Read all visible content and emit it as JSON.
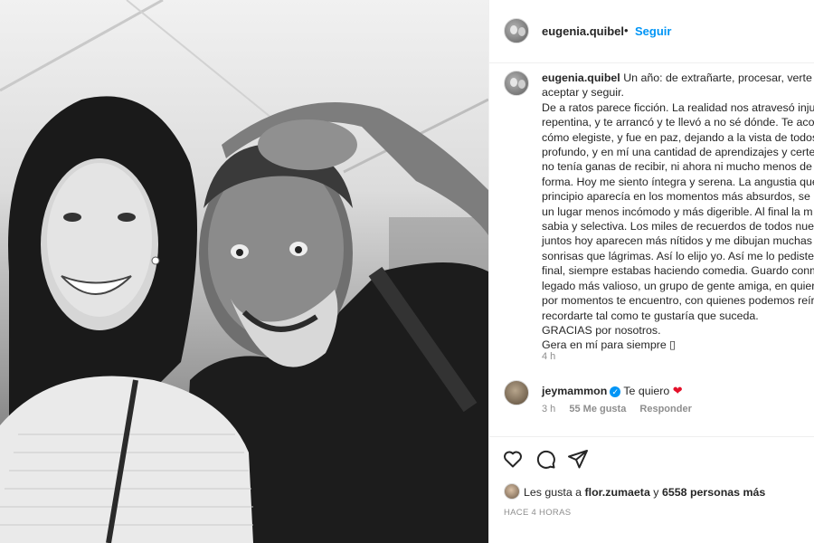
{
  "post": {
    "author": "eugenia.quibel",
    "follow_label": "Seguir",
    "separator": "•",
    "caption_lines": [
      "Un año: de extrañarte, procesar, verte e",
      "aceptar y seguir.",
      "De a ratos parece ficción. La realidad nos atravesó injus",
      "repentina, y te arrancó y te llevó a no sé dónde. Te acor",
      "cómo elegiste, y fue en paz, dejando a la vista de todos",
      "profundo, y en mí una cantidad de aprendizajes y certe",
      "no tenía ganas de recibir, ni ahora ni mucho menos de",
      "forma. Hoy me siento íntegra y serena. La angustia que",
      "principio aparecía en los momentos más absurdos, se u",
      "un lugar menos incómodo y más digerible. Al final la m",
      "sabia y selectiva. Los miles de recuerdos de todos nues",
      "juntos hoy aparecen más nítidos y me dibujan muchas",
      "sonrisas que lágrimas. Así lo elijo yo. Así me lo pediste.",
      "final, siempre estabas haciendo comedia. Guardo conm",
      "legado más valioso, un grupo de gente amiga, en quier",
      "por momentos te encuentro, con quienes podemos reír",
      "recordarte tal como te gustaría que suceda.",
      "GRACIAS por nosotros.",
      "Gera en mí para siempre ▯"
    ],
    "caption_time": "4 h"
  },
  "comment": {
    "user": "jeymammon",
    "text": "Te quiero",
    "emoji": "❤",
    "time": "3 h",
    "likes": "55 Me gusta",
    "reply_label": "Responder"
  },
  "engagement": {
    "likes_prefix": "Les gusta a",
    "liked_by": "flor.zumaeta",
    "likes_and": "y",
    "others": "6558 personas más",
    "date": "HACE 4 HORAS"
  },
  "icons": {
    "like": "heart-outline-icon",
    "comment": "comment-bubble-icon",
    "share": "paper-plane-icon"
  },
  "colors": {
    "accent": "#0095f6",
    "text": "#262626",
    "muted": "#8e8e8e",
    "heart": "#e4112a"
  }
}
